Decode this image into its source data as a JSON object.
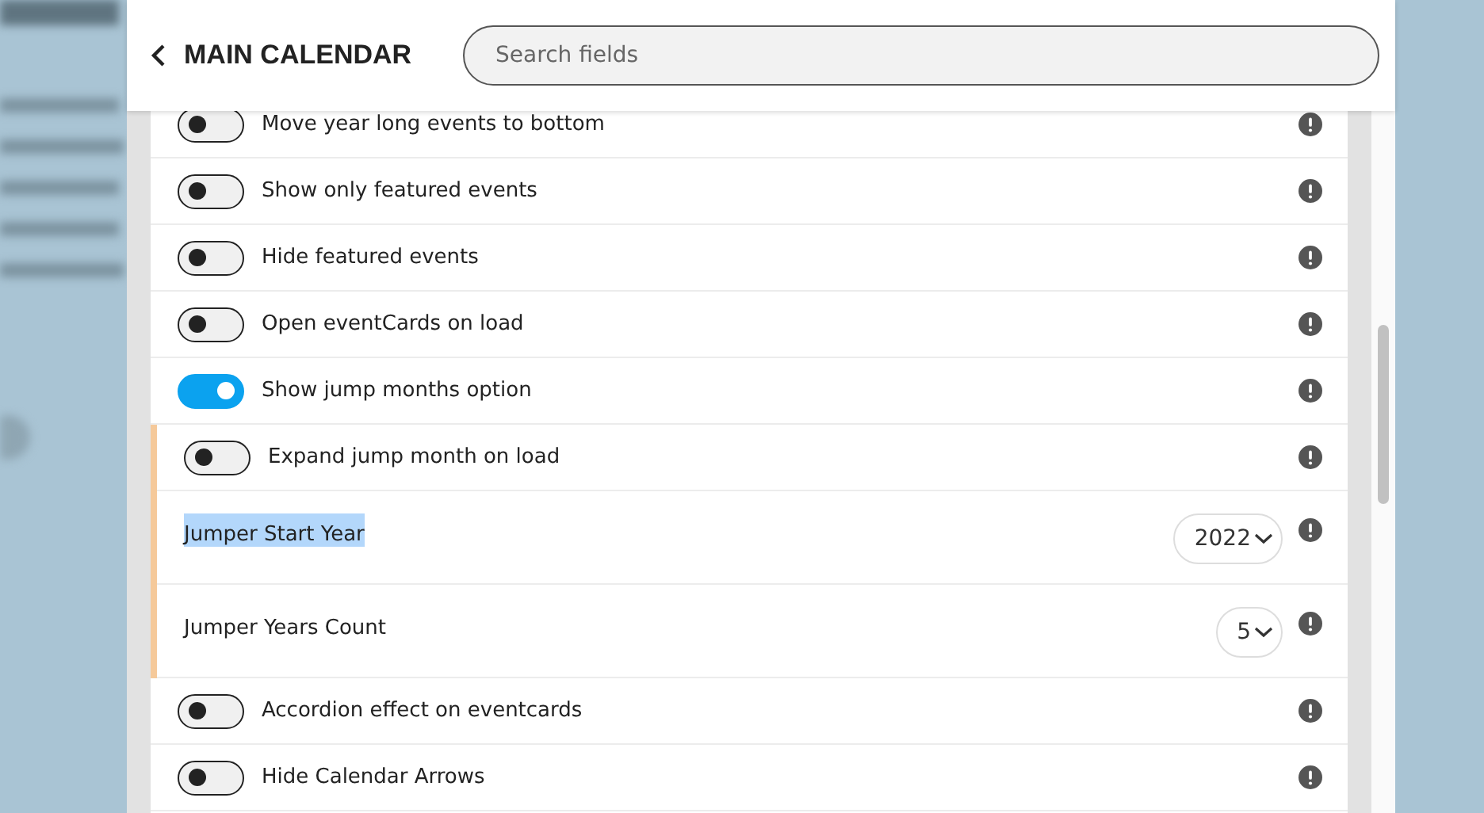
{
  "header": {
    "title": "MAIN CALENDAR",
    "search": {
      "placeholder": "Search fields"
    }
  },
  "settings": [
    {
      "kind": "toggle",
      "label": "Move year long events to bottom",
      "on": false
    },
    {
      "kind": "toggle",
      "label": "Show only featured events",
      "on": false
    },
    {
      "kind": "toggle",
      "label": "Hide featured events",
      "on": false
    },
    {
      "kind": "toggle",
      "label": "Open eventCards on load",
      "on": false
    },
    {
      "kind": "toggle",
      "label": "Show jump months option",
      "on": true
    },
    {
      "kind": "group",
      "children": [
        {
          "kind": "toggle",
          "label": "Expand jump month on load",
          "on": false
        },
        {
          "kind": "select",
          "label": "Jumper Start Year",
          "value": "2022",
          "highlighted": true
        },
        {
          "kind": "select",
          "label": "Jumper Years Count",
          "value": "5",
          "highlighted": false
        }
      ]
    },
    {
      "kind": "toggle",
      "label": "Accordion effect on eventcards",
      "on": false
    },
    {
      "kind": "toggle",
      "label": "Hide Calendar Arrows",
      "on": false
    }
  ]
}
